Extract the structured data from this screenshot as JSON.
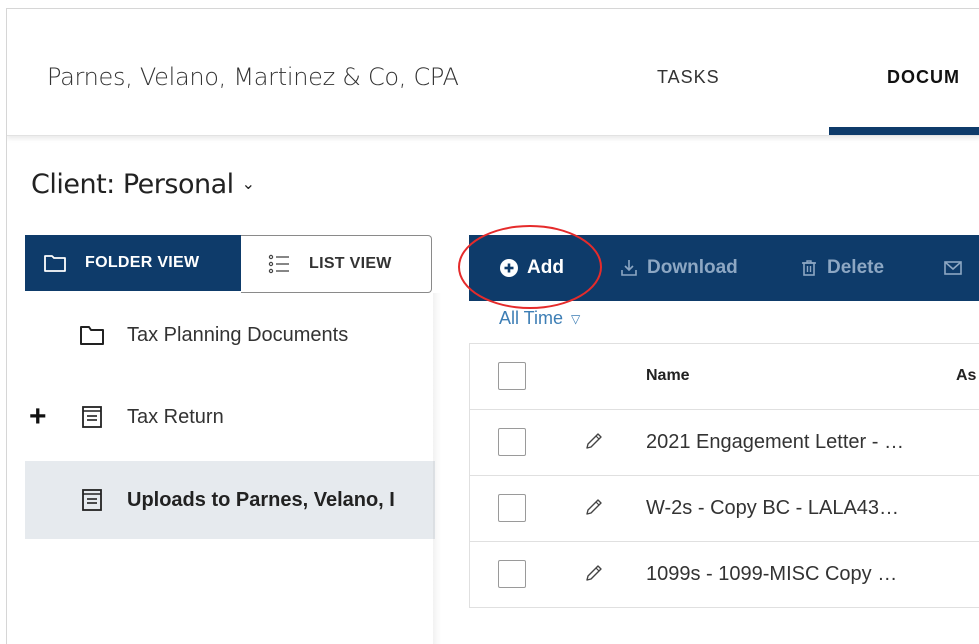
{
  "header": {
    "firm_name": "Parnes, Velano, Martinez & Co, CPA",
    "tabs": [
      {
        "label": "TASKS"
      },
      {
        "label": "DOCUMENTS",
        "visible_text": "DOCUM",
        "active": true
      }
    ]
  },
  "client": {
    "label": "Client: Personal"
  },
  "view_toggle": {
    "folder_label": "FOLDER VIEW",
    "list_label": "LIST VIEW",
    "active": "folder"
  },
  "tree": {
    "items": [
      {
        "label": "Tax Planning Documents",
        "icon": "folder-icon"
      },
      {
        "label": "Tax Return",
        "icon": "document-icon",
        "expandable": true
      },
      {
        "label": "Uploads to Parnes, Velano, I",
        "icon": "document-icon",
        "selected": true
      }
    ]
  },
  "toolbar": {
    "add_label": "Add",
    "download_label": "Download",
    "delete_label": "Delete"
  },
  "filter": {
    "label": "All Time"
  },
  "table": {
    "columns": [
      "Name",
      "As"
    ],
    "rows": [
      {
        "name": "2021 Engagement Letter - …"
      },
      {
        "name": "W-2s - Copy BC - LALA43…"
      },
      {
        "name": "1099s - 1099-MISC Copy …"
      }
    ]
  },
  "colors": {
    "primary": "#0e3b6a",
    "link": "#3d7eb5",
    "annotation": "#e52b2b",
    "selected_row": "#e6eaee"
  }
}
